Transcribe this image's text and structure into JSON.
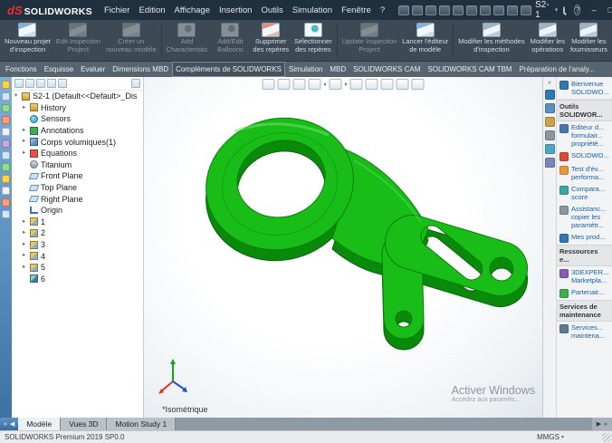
{
  "glyphs": {
    "collapsed": "▸",
    "expanded": "▾",
    "caret": "▾",
    "prev": "◀",
    "next": "▶",
    "first": "«",
    "last": "»"
  },
  "titlebar": {
    "logo_prefix": "dS",
    "brand": "SOLIDWORKS",
    "menus": [
      "Fichier",
      "Edition",
      "Affichage",
      "Insertion",
      "Outils",
      "Simulation",
      "Fenêtre",
      "?"
    ],
    "doc_title": "S2-1",
    "help": "?",
    "window_controls": {
      "minimize": "–",
      "maximize": "□",
      "close": "×"
    }
  },
  "ribbon": {
    "buttons": [
      {
        "label": "Nouveau projet\nd'inspection",
        "enabled": true
      },
      {
        "label": "Edit Inspection\nProject",
        "enabled": false
      },
      {
        "label": "Créer un\nnouveau modèle",
        "enabled": false
      },
      {
        "label": "Add\nCharacteristic",
        "enabled": false
      },
      {
        "label": "Add/Edit\nBalloons",
        "enabled": false
      },
      {
        "label": "Supprimer\ndes repères",
        "enabled": true
      },
      {
        "label": "Sélectionner\ndes repères",
        "enabled": true
      },
      {
        "label": "Update Inspection\nProject",
        "enabled": false
      },
      {
        "label": "Lancer l'éditeur\nde modèle",
        "enabled": true
      },
      {
        "label": "Modifier les méthodes\nd'inspection",
        "enabled": true
      },
      {
        "label": "Modifier les\nopérations",
        "enabled": true
      },
      {
        "label": "Modifier les\nfournisseurs",
        "enabled": true
      }
    ]
  },
  "tabs": {
    "items": [
      "Fonctions",
      "Esquisse",
      "Evaluer",
      "Dimensions MBD",
      "Compléments de SOLIDWORKS",
      "Simulation",
      "MBD",
      "SOLIDWORKS CAM",
      "SOLIDWORKS CAM TBM",
      "Préparation de l'analy..."
    ],
    "active": "Compléments de SOLIDWORKS"
  },
  "tree": {
    "root": "S2-1 (Default<<Default>_Dis",
    "items": [
      "History",
      "Sensors",
      "Annotations",
      "Corps volumiques(1)",
      "Equations",
      "Titanium",
      "Front Plane",
      "Top Plane",
      "Right Plane",
      "Origin",
      "1",
      "2",
      "3",
      "4",
      "5",
      "6"
    ]
  },
  "viewport": {
    "view_label": "*Isométrique",
    "watermark_line1": "Activer Windows",
    "watermark_line2": "Accédez aux paramètr..."
  },
  "taskpane": {
    "welcome": "Bienvenue\nSOLIDWO...",
    "sections": [
      {
        "title": "Outils\nSOLIDWOR...",
        "items": [
          "Editeur d...\nformulair...\npropriété...",
          "SOLIDWO...",
          "Test d'év...\nperforma...",
          "Compara...\nscore",
          "Assistanc...\ncopier les\nparamétr...",
          "Mes prod..."
        ]
      },
      {
        "title": "Ressources e...",
        "items": [
          "3DEXPER...\nMarketpla...",
          "Partenair..."
        ]
      },
      {
        "title": "Services de\nmaintenance",
        "items": [
          "Services...\nmaintena..."
        ]
      }
    ]
  },
  "bottombar": {
    "tabs": [
      "Modèle",
      "Vues 3D",
      "Motion Study 1"
    ],
    "active": "Modèle"
  },
  "statusbar": {
    "left": "SOLIDWORKS Premium 2019 SP0.0",
    "units": "MMGS"
  },
  "colors": {
    "part_green": "#18bd18",
    "part_green_dark": "#0a8a0a",
    "titlebar_bg": "#20303e",
    "accent_blue": "#3c72a4"
  }
}
